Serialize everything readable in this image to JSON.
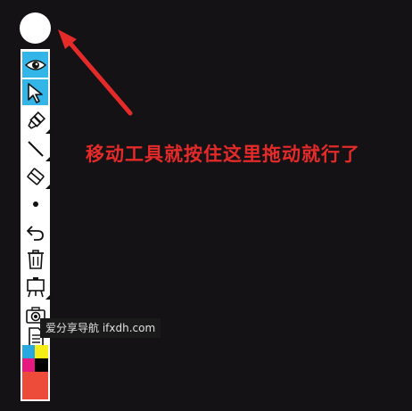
{
  "annotation": {
    "text": "移动工具就按住这里拖动就行了",
    "color": "#e52a2a"
  },
  "watermark": {
    "text": "爱分享导航 ifxdh.com"
  },
  "toolbar": {
    "tools": [
      {
        "name": "eye-icon",
        "active": true
      },
      {
        "name": "cursor-icon",
        "active": true
      },
      {
        "name": "highlighter-icon",
        "active": false
      },
      {
        "name": "line-icon",
        "active": false
      },
      {
        "name": "eraser-icon",
        "active": false
      },
      {
        "name": "dot-icon",
        "active": false
      },
      {
        "name": "undo-icon",
        "active": false
      },
      {
        "name": "trash-icon",
        "active": false
      },
      {
        "name": "easel-icon",
        "active": false
      },
      {
        "name": "camera-icon",
        "active": false
      },
      {
        "name": "document-icon",
        "active": false
      }
    ],
    "palette": [
      "#29a8e0",
      "#f6ec16",
      "#e5197f",
      "#000000",
      "#ee4c3b"
    ],
    "accent": "#33b5e8"
  }
}
